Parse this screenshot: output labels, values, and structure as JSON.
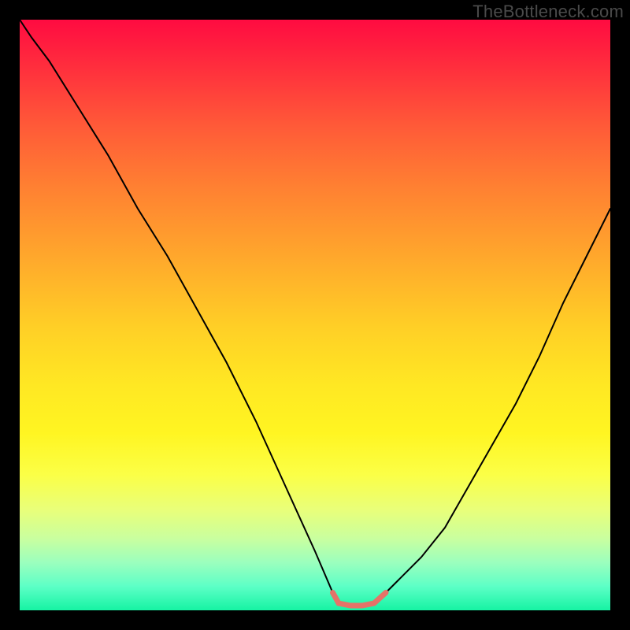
{
  "watermark": {
    "text": "TheBottleneck.com"
  },
  "chart_data": {
    "type": "line",
    "title": "",
    "xlabel": "",
    "ylabel": "",
    "xlim": [
      0,
      100
    ],
    "ylim": [
      0,
      100
    ],
    "series": [
      {
        "name": "left-limb",
        "x": [
          0,
          2,
          5,
          10,
          15,
          20,
          25,
          30,
          35,
          40,
          45,
          50,
          53
        ],
        "y": [
          100,
          97,
          93,
          85,
          77,
          68,
          60,
          51,
          42,
          32,
          21,
          10,
          3
        ],
        "color": "#000000",
        "width": 2
      },
      {
        "name": "right-limb",
        "x": [
          62,
          64,
          68,
          72,
          76,
          80,
          84,
          88,
          92,
          96,
          100
        ],
        "y": [
          3,
          5,
          9,
          14,
          21,
          28,
          35,
          43,
          52,
          60,
          68
        ],
        "color": "#000000",
        "width": 2
      },
      {
        "name": "min-bracket",
        "x": [
          53,
          54,
          56,
          58,
          60,
          62
        ],
        "y": [
          3,
          1.2,
          0.8,
          0.8,
          1.2,
          3
        ],
        "color": "#e57368",
        "width": 7
      }
    ]
  }
}
